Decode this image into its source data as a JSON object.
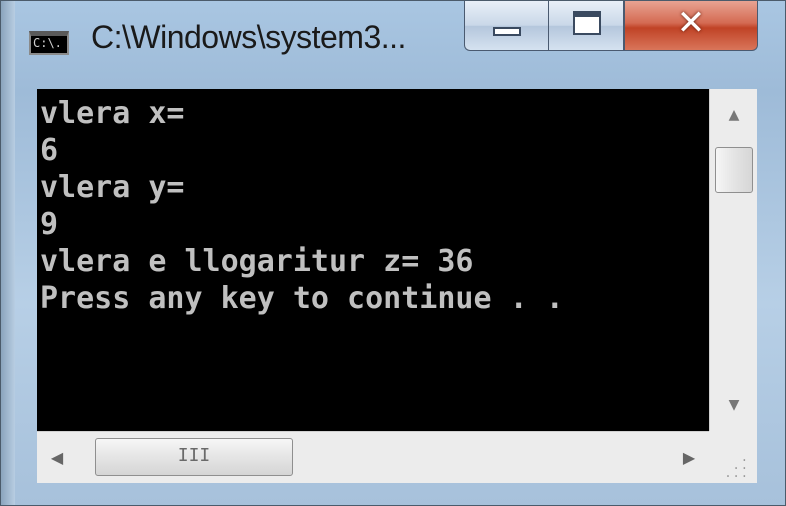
{
  "window": {
    "title": "C:\\Windows\\system3...",
    "icon_label": "C:\\."
  },
  "console": {
    "lines": [
      "vlera x=",
      "6",
      "vlera y=",
      "9",
      "vlera e llogaritur z= 36",
      "Press any key to continue . ."
    ]
  },
  "scrollbar": {
    "up_glyph": "▲",
    "down_glyph": "▼",
    "left_glyph": "◀",
    "right_glyph": "▶",
    "thumb_grip": "III"
  },
  "colors": {
    "console_bg": "#000000",
    "console_fg": "#c0c0c0",
    "close_button": "#c94a2d"
  }
}
